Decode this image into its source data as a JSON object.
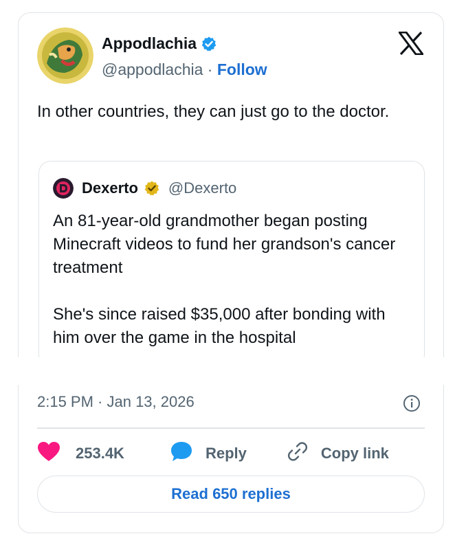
{
  "tweet": {
    "author": {
      "display_name": "Appodlachia",
      "handle": "@appodlachia",
      "separator": "·",
      "follow_label": "Follow",
      "verified": true
    },
    "text": "In other countries, they can just go to the doctor.",
    "timestamp": "2:15 PM · Jan 13, 2026",
    "likes": "253.4K",
    "reply_label": "Reply",
    "copy_link_label": "Copy link",
    "read_replies_label": "Read 650 replies"
  },
  "quoted_tweet": {
    "display_name": "Dexerto",
    "handle": "@Dexerto",
    "verified_type": "gold",
    "paragraphs": [
      "An 81-year-old grandmother began posting Minecraft videos to fund her grandson's cancer treatment",
      "She's since raised $35,000 after bonding with him over the game in the hospital"
    ]
  },
  "icons": {
    "verified": "verified-badge-icon",
    "gold_verified": "gold-verified-badge-icon",
    "logo": "x-logo-icon",
    "info": "info-icon",
    "like": "heart-icon",
    "reply": "reply-bubble-icon",
    "copy": "link-icon"
  },
  "colors": {
    "accent_blue": "#1d6fd1",
    "verified_blue": "#1d9bf0",
    "gold": "#e2b719",
    "heart": "#f91880",
    "muted_text": "#536471",
    "border": "#dfe3e7"
  }
}
